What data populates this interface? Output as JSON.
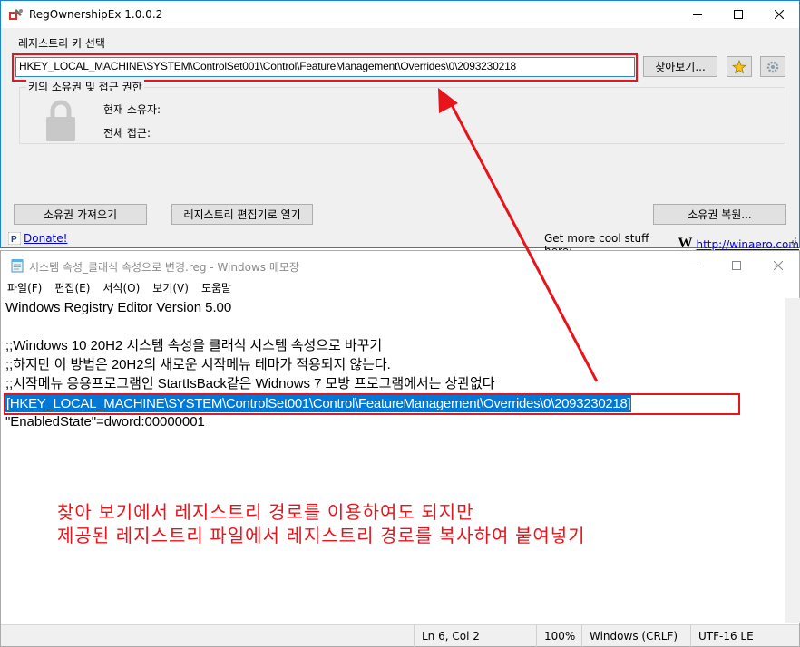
{
  "reg_window": {
    "title": "RegOwnershipEx 1.0.0.2",
    "section_label": "레지스트리 키 선택",
    "key_path": "HKEY_LOCAL_MACHINE\\SYSTEM\\ControlSet001\\Control\\FeatureManagement\\Overrides\\0\\2093230218",
    "browse_label": "찾아보기...",
    "group_title": "키의 소유권 및 접근 권한",
    "current_owner_label": "현재 소유자:",
    "full_access_label": "전체 접근:",
    "take_ownership_label": "소유권 가져오기",
    "open_regedit_label": "레지스트리 편집기로 열기",
    "restore_ownership_label": "소유권 복원...",
    "donate_label": "Donate!",
    "cool_stuff_label": "Get more cool stuff here:",
    "winaero_link": "http://winaero.com",
    "winaero_logo": "W"
  },
  "notepad": {
    "title": "시스템 속성_클래식 속성으로 변경.reg - Windows 메모장",
    "menu": [
      "파일(F)",
      "편집(E)",
      "서식(O)",
      "보기(V)",
      "도움말"
    ],
    "lines": [
      "Windows Registry Editor Version 5.00",
      "",
      ";;Windows 10 20H2 시스템 속성을 클래식 시스템 속성으로 바꾸기",
      ";;하지만 이 방법은 20H2의 새로운 시작메뉴 테마가 적용되지 않는다.",
      ";;시작메뉴 응용프로그램인 StartIsBack같은 Widnows 7 모방 프로그램에서는 상관없다",
      "",
      "\"EnabledState\"=dword:00000001"
    ],
    "selected_text": "[HKEY_LOCAL_MACHINE\\SYSTEM\\ControlSet001\\Control\\FeatureManagement\\Overrides\\0\\2093230218]",
    "annotation_line1": "찾아 보기에서 레지스트리 경로를 이용하여도 되지만",
    "annotation_line2": "제공된 레지스트리 파일에서 레지스트리 경로를 복사하여 붙여넣기",
    "status": {
      "position": "Ln 6, Col 2",
      "zoom": "100%",
      "line_endings": "Windows (CRLF)",
      "encoding": "UTF-16 LE"
    }
  },
  "colors": {
    "annotation_red": "#e8141b",
    "selection_blue": "#0078d7",
    "link_blue": "#0000ee"
  }
}
